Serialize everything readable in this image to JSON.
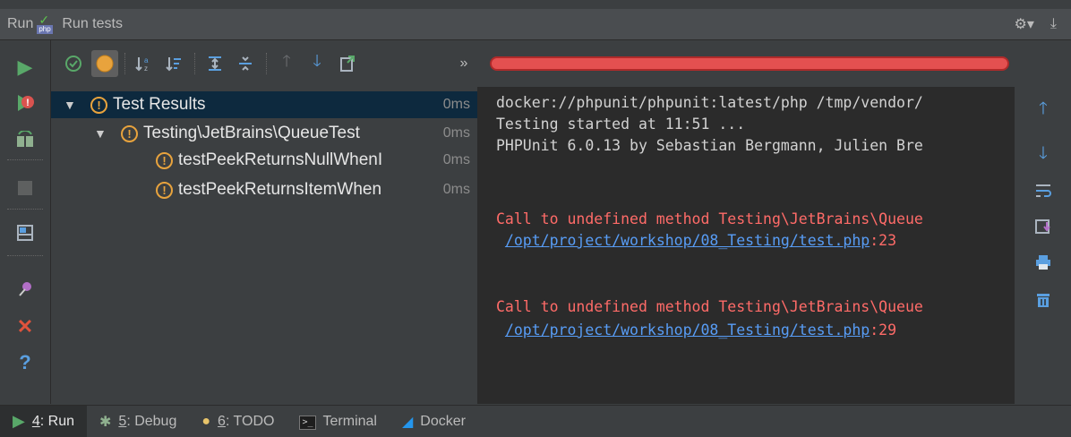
{
  "window": {
    "tool_label": "Run",
    "config_icon_label": "php",
    "title": "Run tests",
    "settings_glyph": "⚙▾",
    "pin_glyph": "⤓"
  },
  "left_toolbar": {
    "icons": [
      "rerun-icon",
      "rerun-failed-icon",
      "toggle-auto-test-icon",
      "stop-icon",
      "layout-icon",
      "pin-tab-icon",
      "close-icon",
      "help-icon"
    ]
  },
  "toolbar": {
    "more_label": "»",
    "progress_state": "failed",
    "progress_fraction": 1.0
  },
  "tree": {
    "rows": [
      {
        "name": "Test Results",
        "time": "0ms"
      },
      {
        "name": "Testing\\JetBrains\\QueueTest",
        "time": "0ms"
      },
      {
        "name": "testPeekReturnsNullWhenI",
        "time": "0ms"
      },
      {
        "name": "testPeekReturnsItemWhen",
        "time": "0ms"
      }
    ]
  },
  "console": {
    "line1": "docker://phpunit/phpunit:latest/php /tmp/vendor/",
    "line2": "Testing started at 11:51 ...",
    "line3": "PHPUnit 6.0.13 by Sebastian Bergmann, Julien Bre",
    "error1": "Call to undefined method Testing\\JetBrains\\Queue",
    "link1": "/opt/project/workshop/08_Testing/test.php",
    "link1_line": ":23",
    "error2": "Call to undefined method Testing\\JetBrains\\Queue",
    "link2": "/opt/project/workshop/08_Testing/test.php",
    "link2_line": ":29"
  },
  "status_bar": {
    "tabs": [
      {
        "mnemonic": "4",
        "label": ": Run"
      },
      {
        "mnemonic": "5",
        "label": ": Debug"
      },
      {
        "mnemonic": "6",
        "label": ": TODO"
      },
      {
        "mnemonic": "",
        "label": "Terminal"
      },
      {
        "mnemonic": "",
        "label": "Docker"
      }
    ]
  },
  "colors": {
    "accent_blue": "#589df6",
    "error_red": "#ff6b68",
    "warning_orange": "#e8a33d",
    "run_green": "#59a869"
  }
}
